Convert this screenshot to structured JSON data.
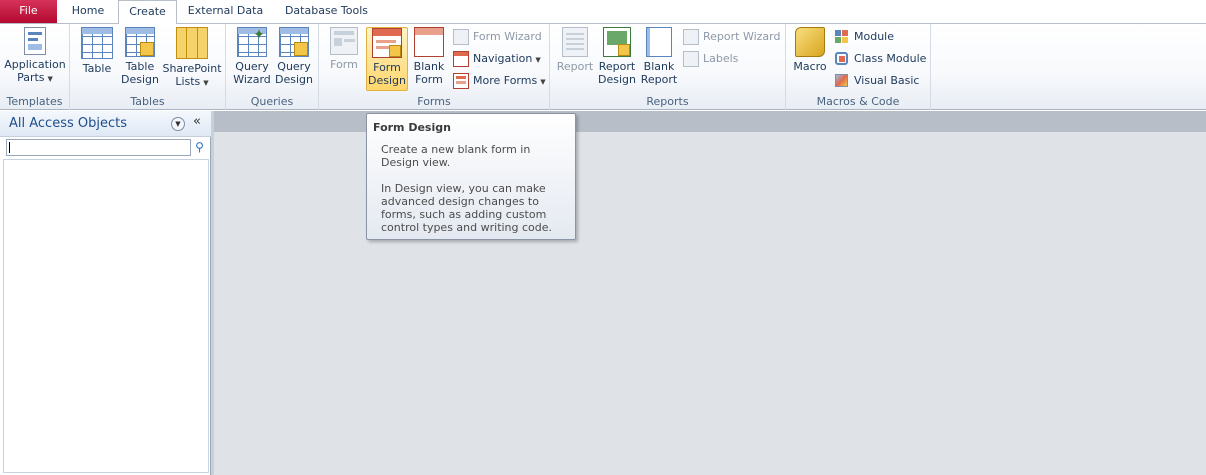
{
  "tabs": {
    "file": "File",
    "home": "Home",
    "create": "Create",
    "external": "External Data",
    "dbtools": "Database Tools"
  },
  "ribbon": {
    "templates": {
      "label": "Templates",
      "app_parts_1": "Application",
      "app_parts_2": "Parts"
    },
    "tables": {
      "label": "Tables",
      "table": "Table",
      "table_design_1": "Table",
      "table_design_2": "Design",
      "sharepoint_1": "SharePoint",
      "sharepoint_2": "Lists"
    },
    "queries": {
      "label": "Queries",
      "qwizard_1": "Query",
      "qwizard_2": "Wizard",
      "qdesign_1": "Query",
      "qdesign_2": "Design"
    },
    "forms": {
      "label": "Forms",
      "form": "Form",
      "form_design_1": "Form",
      "form_design_2": "Design",
      "blank_form_1": "Blank",
      "blank_form_2": "Form",
      "form_wizard": "Form Wizard",
      "navigation": "Navigation",
      "more_forms": "More Forms"
    },
    "reports": {
      "label": "Reports",
      "report": "Report",
      "report_design_1": "Report",
      "report_design_2": "Design",
      "blank_report_1": "Blank",
      "blank_report_2": "Report",
      "report_wizard": "Report Wizard",
      "labels": "Labels"
    },
    "macros": {
      "label": "Macros & Code",
      "macro": "Macro",
      "module": "Module",
      "class_module": "Class Module",
      "visual_basic": "Visual Basic"
    }
  },
  "nav": {
    "title": "All Access Objects",
    "search_value": ""
  },
  "tooltip": {
    "title": "Form Design",
    "p1": "Create a new blank form in Design view.",
    "p2": "In Design view, you can make advanced design changes to forms, such as adding custom control types and writing code."
  },
  "colors": {
    "file_tab": "#c1103a",
    "ribbon_text": "#1e395b",
    "active_button": "#ffd66b"
  }
}
